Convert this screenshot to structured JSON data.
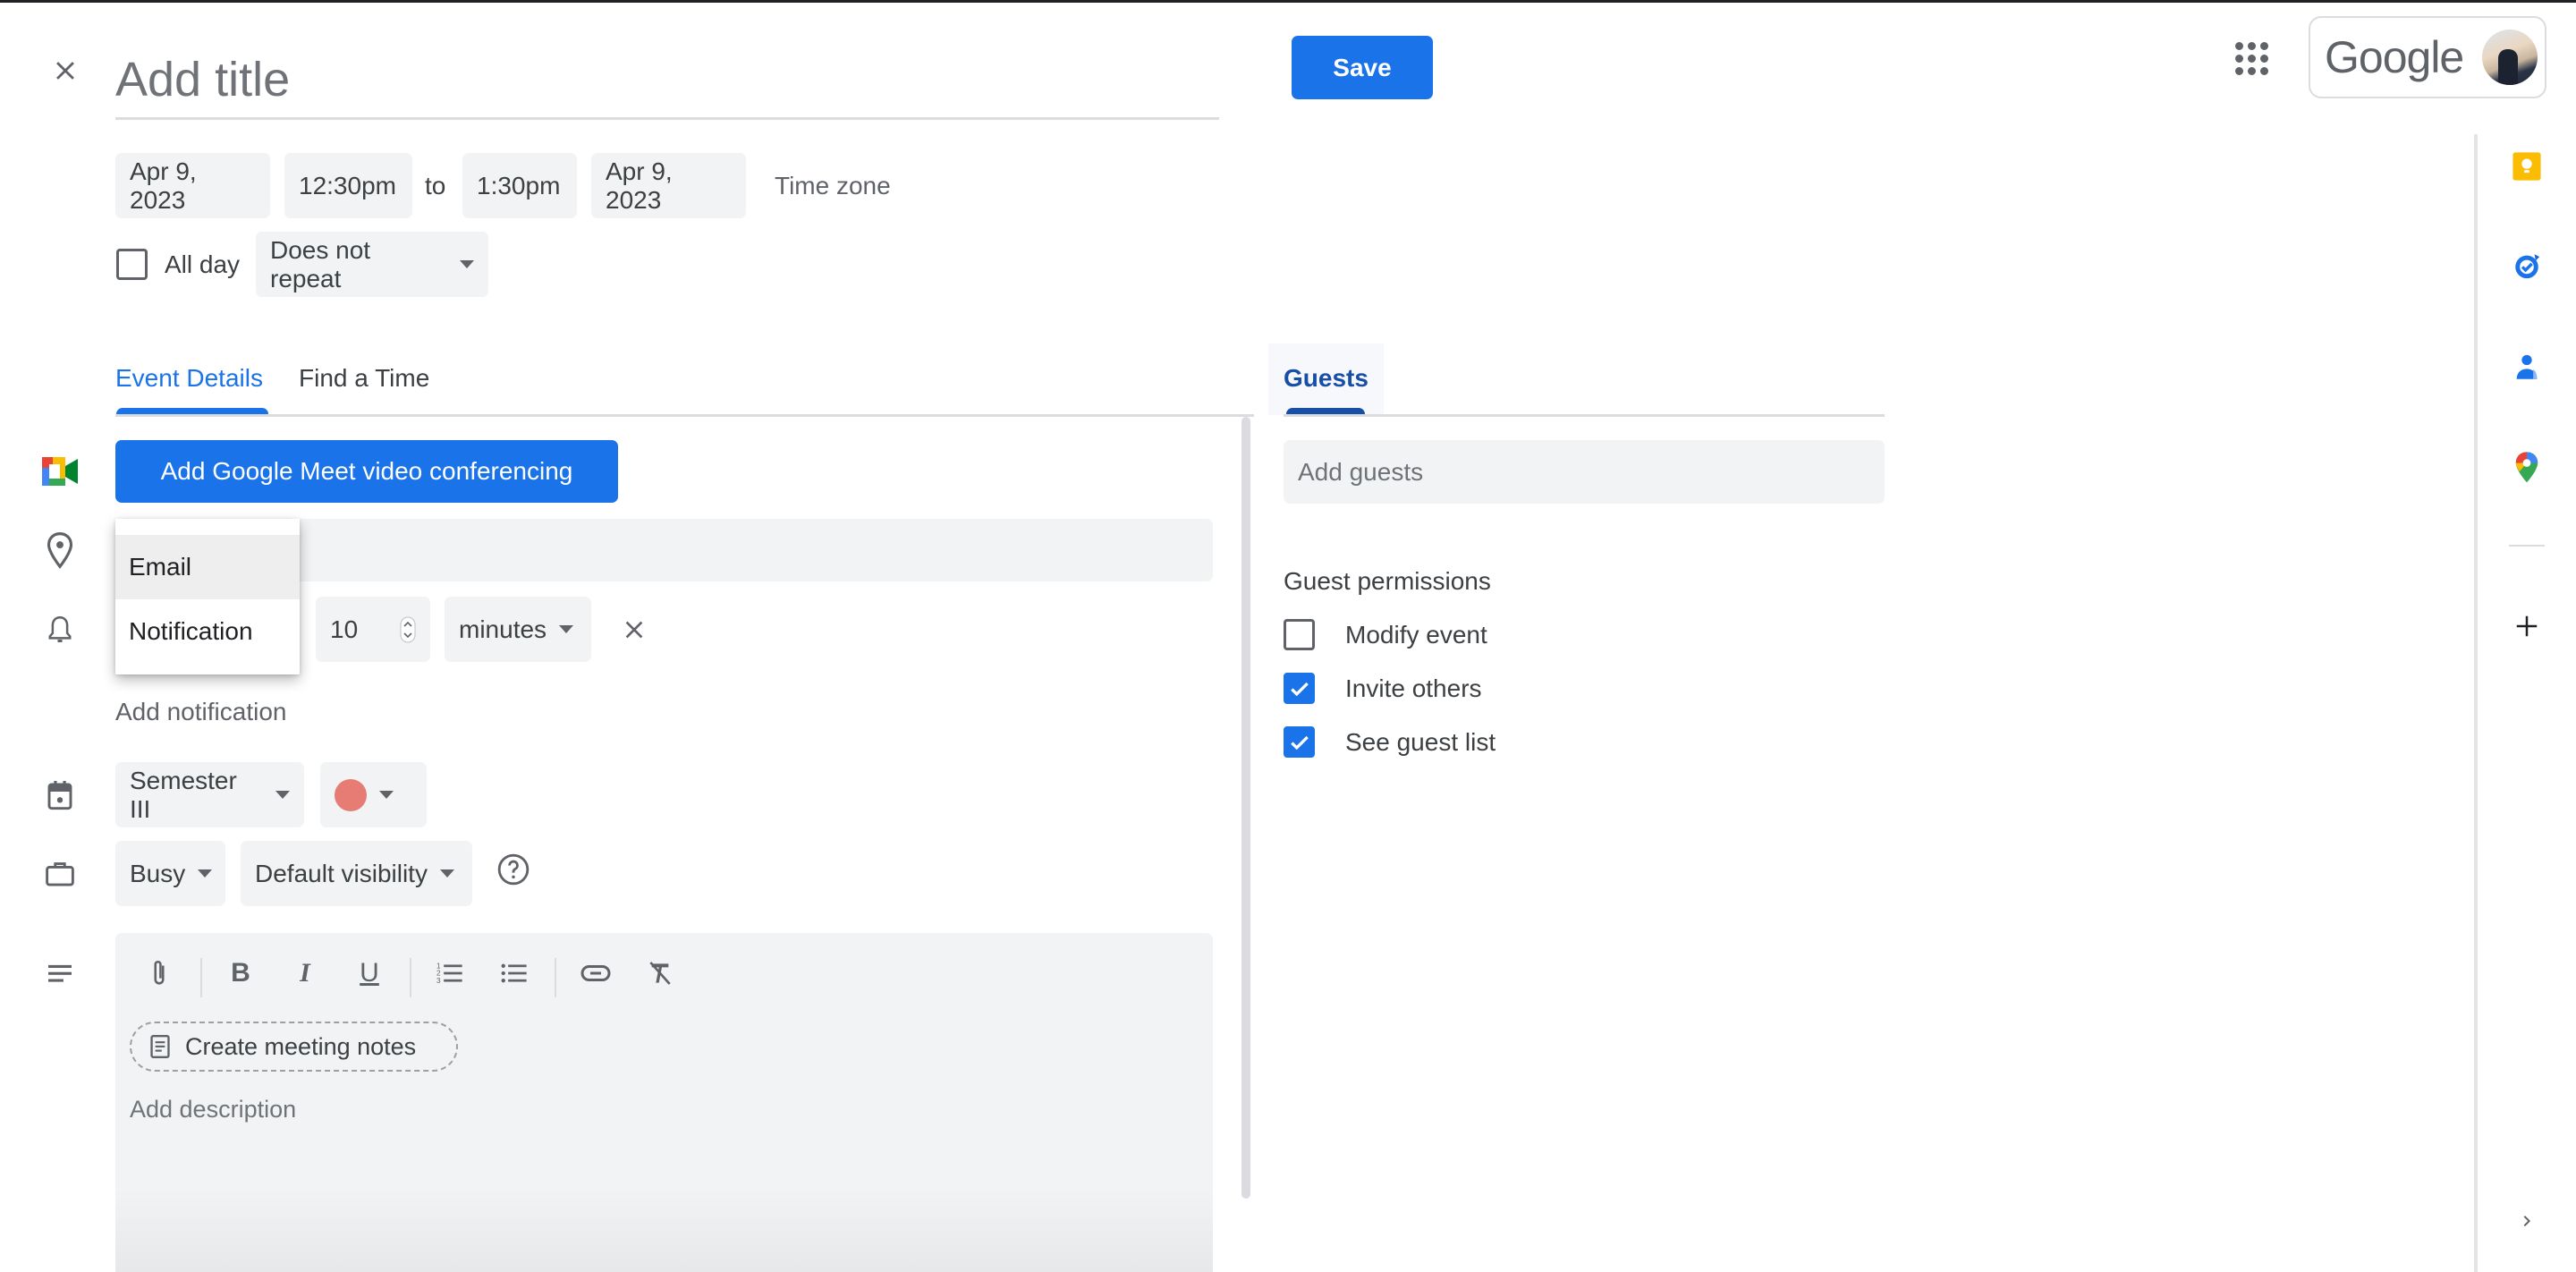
{
  "header": {
    "close_label": "Close",
    "title_placeholder": "Add title",
    "title_value": "",
    "save_label": "Save",
    "account_brand": "Google"
  },
  "datetime": {
    "start_date": "Apr 9, 2023",
    "start_time": "12:30pm",
    "to_label": "to",
    "end_time": "1:30pm",
    "end_date": "Apr 9, 2023",
    "timezone_label": "Time zone",
    "all_day_label": "All day",
    "all_day_checked": false,
    "repeat_value": "Does not repeat"
  },
  "tabs": {
    "event_details": "Event Details",
    "find_a_time": "Find a Time",
    "guests": "Guests",
    "active": "Event Details"
  },
  "details": {
    "meet_button_label": "Add Google Meet video conferencing",
    "location_placeholder": "",
    "notification_menu": {
      "items": [
        "Email",
        "Notification"
      ],
      "highlighted": "Email"
    },
    "notification_amount": "10",
    "notification_unit": "minutes",
    "add_notification_label": "Add notification",
    "calendar_value": "Semester III",
    "event_color": "#e67c73",
    "availability_value": "Busy",
    "visibility_value": "Default visibility",
    "help_label": "?",
    "toolbar": {
      "attach": "attachment-icon",
      "bold": "B",
      "italic": "I",
      "underline": "U",
      "numbered_list": "numbered-list-icon",
      "bulleted_list": "bulleted-list-icon",
      "link": "link-icon",
      "remove_format": "remove-formatting-icon"
    },
    "meeting_notes_label": "Create meeting notes",
    "description_placeholder": "Add description"
  },
  "guests": {
    "add_placeholder": "Add guests",
    "permissions_title": "Guest permissions",
    "permissions": [
      {
        "label": "Modify event",
        "checked": false
      },
      {
        "label": "Invite others",
        "checked": true
      },
      {
        "label": "See guest list",
        "checked": true
      }
    ]
  },
  "side_panel": {
    "apps": [
      "Keep",
      "Tasks",
      "Contacts",
      "Maps"
    ],
    "add_label": "+",
    "expand_label": ">"
  },
  "colors": {
    "accent": "#1a73e8",
    "chip_bg": "#f1f3f4",
    "keep_yellow": "#fbbc04",
    "event_color": "#e67c73"
  }
}
